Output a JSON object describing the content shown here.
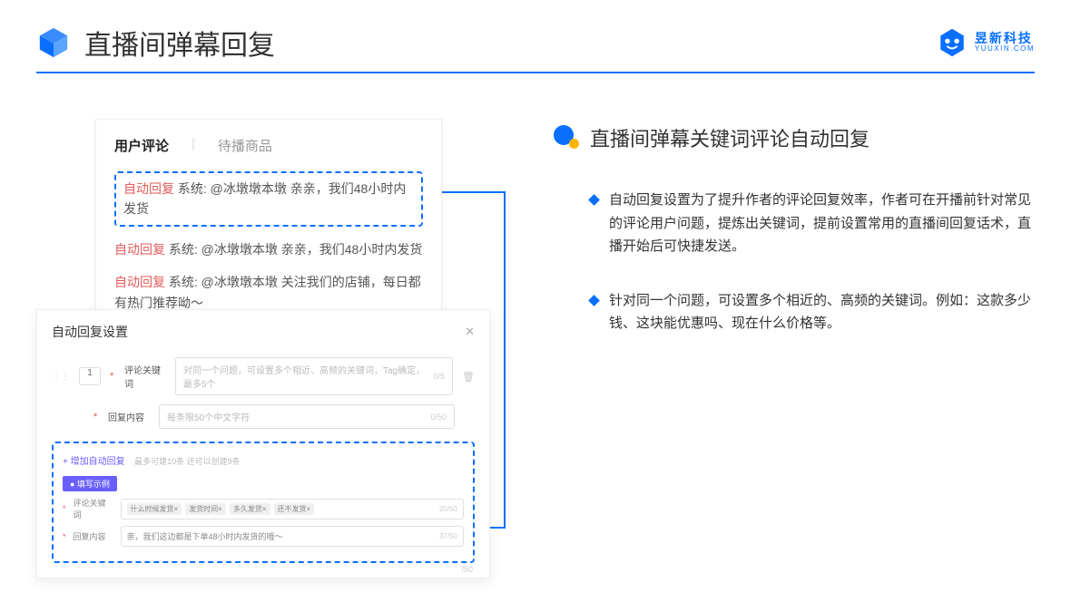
{
  "header": {
    "title": "直播间弹幕回复",
    "logo_cn": "昱新科技",
    "logo_en": "YUUXIN.COM"
  },
  "comments_card": {
    "tab_active": "用户评论",
    "tab_inactive": "待播商品",
    "rows": [
      {
        "tag": "自动回复",
        "text": "系统: @冰墩墩本墩 亲亲，我们48小时内发货"
      },
      {
        "tag": "自动回复",
        "text": "系统: @冰墩墩本墩 亲亲，我们48小时内发货"
      },
      {
        "tag": "自动回复",
        "text": "系统: @冰墩墩本墩 关注我们的店铺，每日都有热门推荐呦～"
      }
    ]
  },
  "settings_card": {
    "title": "自动回复设置",
    "num": "1",
    "keyword_label": "评论关键词",
    "keyword_ph": "对同一个问题，可设置多个相近、高频的关键词，Tag确定，最多5个",
    "keyword_cnt": "0/5",
    "content_label": "回复内容",
    "content_ph": "每条限50个中文字符",
    "content_cnt": "0/50",
    "add_link": "+ 增加自动回复",
    "add_note": "最多可建10条 还可以创建9条",
    "example_badge": "● 填写示例",
    "ex_keyword_label": "评论关键词",
    "ex_tags": [
      "什么时候发货×",
      "发货时间×",
      "多久发货×",
      "还不发货×"
    ],
    "ex_keyword_cnt": "20/50",
    "ex_content_label": "回复内容",
    "ex_content_val": "亲，我们这边都是下单48小时内发货的哦～",
    "ex_content_cnt": "37/50",
    "tail_cnt": "/50"
  },
  "right": {
    "title": "直播间弹幕关键词评论自动回复",
    "bullets": [
      "自动回复设置为了提升作者的评论回复效率，作者可在开播前针对常见的评论用户问题，提炼出关键词，提前设置常用的直播间回复话术，直播开始后可快捷发送。",
      "针对同一个问题，可设置多个相近的、高频的关键词。例如：这款多少钱、这块能优惠吗、现在什么价格等。"
    ]
  }
}
